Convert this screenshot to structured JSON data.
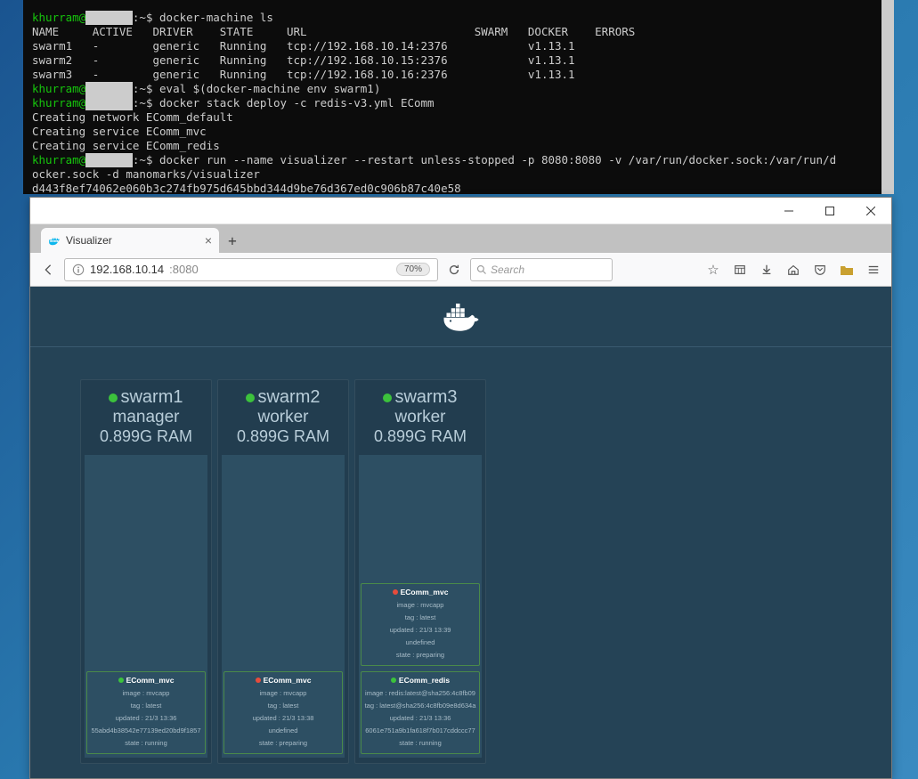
{
  "terminal": {
    "user": "khurram",
    "host_redacted": "       ",
    "prompt_suffix": ":~$",
    "cmd1": "docker-machine ls",
    "header": "NAME     ACTIVE   DRIVER    STATE     URL                         SWARM   DOCKER    ERRORS",
    "row1": "swarm1   -        generic   Running   tcp://192.168.10.14:2376            v1.13.1",
    "row2": "swarm2   -        generic   Running   tcp://192.168.10.15:2376            v1.13.1",
    "row3": "swarm3   -        generic   Running   tcp://192.168.10.16:2376            v1.13.1",
    "cmd2": "eval $(docker-machine env swarm1)",
    "cmd3": "docker stack deploy -c redis-v3.yml EComm",
    "out1": "Creating network EComm_default",
    "out2": "Creating service EComm_mvc",
    "out3": "Creating service EComm_redis",
    "cmd4": "docker run --name visualizer --restart unless-stopped -p 8080:8080 -v /var/run/docker.sock:/var/run/d",
    "cmd4_wrap": "ocker.sock -d manomarks/visualizer",
    "out4": "d443f8ef74062e060b3c274fb975d645bbd344d9be76d367ed0c906b87c40e58"
  },
  "browser": {
    "tab_title": "Visualizer",
    "url_base": "192.168.10.14",
    "url_port": ":8080",
    "zoom": "70%",
    "search_placeholder": "Search"
  },
  "visualizer": {
    "nodes": [
      {
        "name": "swarm1",
        "role": "manager",
        "ram": "0.899G RAM",
        "services": [
          {
            "status": "green",
            "name": "EComm_mvc",
            "lines": [
              "image : mvcapp",
              "tag : latest",
              "updated : 21/3 13:36",
              "55abd4b38542e77139ed20bd9f1857",
              "state : running"
            ]
          }
        ]
      },
      {
        "name": "swarm2",
        "role": "worker",
        "ram": "0.899G RAM",
        "services": [
          {
            "status": "red",
            "name": "EComm_mvc",
            "lines": [
              "image : mvcapp",
              "tag : latest",
              "updated : 21/3 13:38",
              "undefined",
              "state : preparing"
            ]
          }
        ]
      },
      {
        "name": "swarm3",
        "role": "worker",
        "ram": "0.899G RAM",
        "services": [
          {
            "status": "red",
            "name": "EComm_mvc",
            "lines": [
              "image : mvcapp",
              "tag : latest",
              "updated : 21/3 13:39",
              "undefined",
              "state : preparing"
            ]
          },
          {
            "status": "green",
            "name": "EComm_redis",
            "lines": [
              "image : redis:latest@sha256:4c8fb09",
              "tag : latest@sha256:4c8fb09e8d634a",
              "updated : 21/3 13:36",
              "6061e751a9b1fa618f7b017cddccc77",
              "state : running"
            ]
          }
        ]
      }
    ]
  }
}
